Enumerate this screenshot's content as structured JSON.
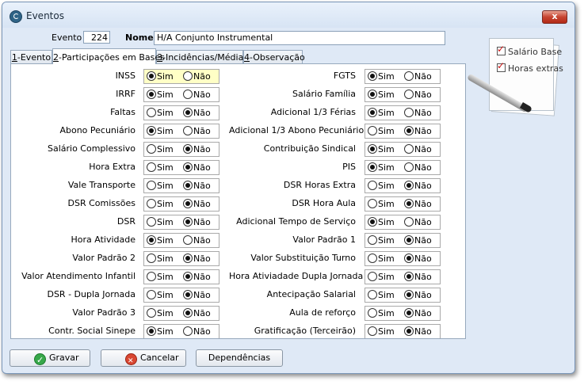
{
  "window": {
    "title": "Eventos",
    "close_symbol": "x"
  },
  "header": {
    "evento_label": "Evento",
    "evento_value": "224",
    "nome_label": "Nome",
    "nome_value": "H/A Conjunto Instrumental"
  },
  "notepad": {
    "items": [
      "Salário Base",
      "Horas extras"
    ]
  },
  "tabs": [
    {
      "key": "1",
      "rest": "-Evento"
    },
    {
      "key": "2",
      "rest": "-Participações em Bases"
    },
    {
      "key": "3",
      "rest": "-Incidências/Médias"
    },
    {
      "key": "4",
      "rest": "-Observação"
    }
  ],
  "active_tab": 1,
  "options": {
    "yes": "Sim",
    "no": "Não"
  },
  "left_fields": [
    {
      "label": "INSS",
      "value": "Sim",
      "highlight": true
    },
    {
      "label": "IRRF",
      "value": "Sim"
    },
    {
      "label": "Faltas",
      "value": "Não"
    },
    {
      "label": "Abono Pecuniário",
      "value": "Sim"
    },
    {
      "label": "Salário Complessivo",
      "value": "Não"
    },
    {
      "label": "Hora Extra",
      "value": "Não"
    },
    {
      "label": "Vale Transporte",
      "value": "Não"
    },
    {
      "label": "DSR Comissões",
      "value": "Não"
    },
    {
      "label": "DSR",
      "value": "Não"
    },
    {
      "label": "Hora Atividade",
      "value": "Sim"
    },
    {
      "label": "Valor Padrão 2",
      "value": "Não"
    },
    {
      "label": "Valor Atendimento Infantil",
      "value": "Não"
    },
    {
      "label": "DSR - Dupla Jornada",
      "value": "Não"
    },
    {
      "label": "Valor Padrão 3",
      "value": "Não"
    },
    {
      "label": "Contr. Social Sinepe",
      "value": "Sim"
    }
  ],
  "right_fields": [
    {
      "label": "FGTS",
      "value": "Sim"
    },
    {
      "label": "Salário Família",
      "value": "Sim"
    },
    {
      "label": "Adicional 1/3 Férias",
      "value": "Sim"
    },
    {
      "label": "Adicional 1/3 Abono Pecuniário",
      "value": "Não"
    },
    {
      "label": "Contribuição Sindical",
      "value": "Sim"
    },
    {
      "label": "PIS",
      "value": "Sim"
    },
    {
      "label": "DSR Horas Extra",
      "value": "Não"
    },
    {
      "label": "DSR Hora Aula",
      "value": "Não"
    },
    {
      "label": "Adicional Tempo de Serviço",
      "value": "Sim"
    },
    {
      "label": "Valor Padrão 1",
      "value": "Não"
    },
    {
      "label": "Valor Substituição Turno",
      "value": "Não"
    },
    {
      "label": "Hora Ativiadade Dupla Jornada",
      "value": "Não"
    },
    {
      "label": "Antecipação Salarial",
      "value": "Não"
    },
    {
      "label": "Aula de reforço",
      "value": "Não"
    },
    {
      "label": "Gratificação (Terceirão)",
      "value": "Não"
    }
  ],
  "buttons": {
    "save": "Gravar",
    "cancel": "Cancelar",
    "deps": "Dependências"
  },
  "colors": {
    "window_bg": "#dfe9f6",
    "highlight": "#ffffc6",
    "ok_icon": "#37a84a",
    "cancel_icon": "#d94732"
  }
}
